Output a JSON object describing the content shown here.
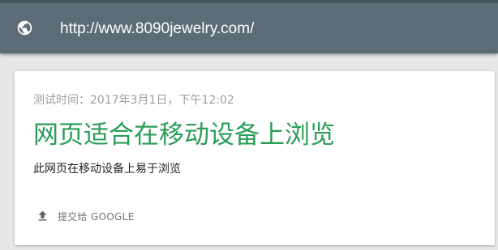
{
  "address_bar": {
    "icon": "globe-icon",
    "url": "http://www.8090jewelry.com/"
  },
  "result_card": {
    "test_time": "测试时间：2017年3月1日，下午12:02",
    "verdict": "网页适合在移动设备上浏览",
    "verdict_color": "#2a9d57",
    "description": "此网页在移动设备上易于浏览",
    "submit_action": {
      "icon": "upload-icon",
      "label": "提交给 GOOGLE"
    }
  }
}
